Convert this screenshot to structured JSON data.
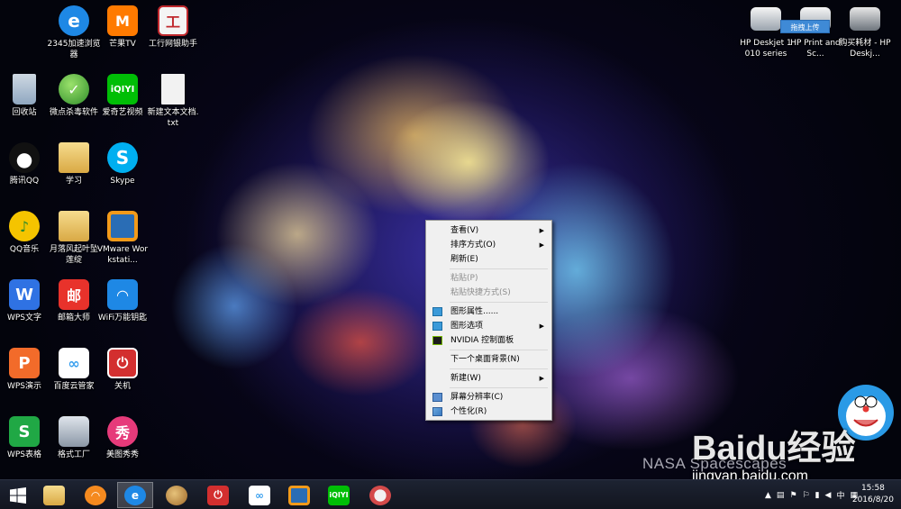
{
  "desktop": {
    "icons": [
      {
        "label": "2345加速浏览器",
        "icon": "ie-browser-icon",
        "color": "#1e88e5"
      },
      {
        "label": "芒果TV",
        "icon": "mango-tv-icon",
        "color": "#ff7a00"
      },
      {
        "label": "工行网银助手",
        "icon": "icbc-icon",
        "color": "#c0282d"
      },
      {
        "label": "回收站",
        "icon": "recycle-bin-icon",
        "color": "#8fa7c0"
      },
      {
        "label": "微点杀毒软件",
        "icon": "antivirus-icon",
        "color": "#47a83c"
      },
      {
        "label": "爱奇艺视频",
        "icon": "iqiyi-icon",
        "color": "#00be06"
      },
      {
        "label": "新建文本文档.txt",
        "icon": "text-file-icon",
        "color": "#f2f2f2"
      },
      {
        "label": "腾讯QQ",
        "icon": "qq-penguin-icon",
        "color": "#111111"
      },
      {
        "label": "学习",
        "icon": "folder-icon",
        "color": "#e8c265"
      },
      {
        "label": "Skype",
        "icon": "skype-icon",
        "color": "#00aff0"
      },
      {
        "label": "QQ音乐",
        "icon": "qq-music-icon",
        "color": "#f5c400"
      },
      {
        "label": "月落风起叶坠莲绽",
        "icon": "folder-icon",
        "color": "#e8c265"
      },
      {
        "label": "VMware Workstati...",
        "icon": "vmware-icon",
        "color": "#f29a1a"
      },
      {
        "label": "WPS文字",
        "icon": "wps-writer-icon",
        "color": "#2f72e3"
      },
      {
        "label": "邮箱大师",
        "icon": "mail-master-icon",
        "color": "#e8322b"
      },
      {
        "label": "WiFi万能钥匙",
        "icon": "wifi-key-icon",
        "color": "#1e88e5"
      },
      {
        "label": "WPS演示",
        "icon": "wps-presentation-icon",
        "color": "#f26b2a"
      },
      {
        "label": "百度云管家",
        "icon": "baidu-cloud-icon",
        "color": "#3aa0ee"
      },
      {
        "label": "关机",
        "icon": "power-icon",
        "color": "#d32f2f"
      },
      {
        "label": "WPS表格",
        "icon": "wps-spreadsheet-icon",
        "color": "#20a845"
      },
      {
        "label": "格式工厂",
        "icon": "format-factory-icon",
        "color": "#9aa6b5"
      },
      {
        "label": "美图秀秀",
        "icon": "meitu-icon",
        "color": "#e63a7a"
      }
    ],
    "right_icons": [
      {
        "label": "HP Deskjet 1010 series",
        "icon": "printer-icon"
      },
      {
        "label": "HP Print and Sc...",
        "icon": "scanner-icon"
      },
      {
        "label": "购买耗材 - HP Deskj...",
        "icon": "printer-supplies-icon"
      }
    ],
    "tooltip": "拖拽上传",
    "watermark": "NASA Spacescapes",
    "baidu_logo": "Baidu经验",
    "baidu_url": "jingyan.baidu.com"
  },
  "context_menu": {
    "items": [
      {
        "label": "查看(V)",
        "submenu": true,
        "disabled": false
      },
      {
        "label": "排序方式(O)",
        "submenu": true,
        "disabled": false
      },
      {
        "label": "刷新(E)",
        "submenu": false,
        "disabled": false
      },
      {
        "separator": true
      },
      {
        "label": "粘贴(P)",
        "submenu": false,
        "disabled": true
      },
      {
        "label": "粘贴快捷方式(S)",
        "submenu": false,
        "disabled": true
      },
      {
        "separator": true
      },
      {
        "label": "图形属性......",
        "submenu": false,
        "disabled": false,
        "icon": "intel-graphics-icon"
      },
      {
        "label": "图形选项",
        "submenu": true,
        "disabled": false,
        "icon": "intel-graphics-icon"
      },
      {
        "label": "NVIDIA 控制面板",
        "submenu": false,
        "disabled": false,
        "icon": "nvidia-icon"
      },
      {
        "separator": true
      },
      {
        "label": "下一个桌面背景(N)",
        "submenu": false,
        "disabled": false
      },
      {
        "separator": true
      },
      {
        "label": "新建(W)",
        "submenu": true,
        "disabled": false
      },
      {
        "separator": true
      },
      {
        "label": "屏幕分辨率(C)",
        "submenu": false,
        "disabled": false,
        "icon": "display-icon"
      },
      {
        "label": "个性化(R)",
        "submenu": false,
        "disabled": false,
        "icon": "personalize-icon"
      }
    ]
  },
  "taskbar": {
    "start_icon": "windows-start-icon",
    "apps": [
      {
        "icon": "file-explorer-icon",
        "color": "#e8c265"
      },
      {
        "icon": "wifi-key-icon",
        "color": "#f58a1f"
      },
      {
        "icon": "ie-browser-icon",
        "color": "#1e88e5",
        "active": true
      },
      {
        "icon": "paint-icon",
        "color": "#c58a3a"
      },
      {
        "icon": "power-icon",
        "color": "#d32f2f"
      },
      {
        "icon": "baidu-cloud-icon",
        "color": "#3aa0ee"
      },
      {
        "icon": "vmware-icon",
        "color": "#f29a1a"
      },
      {
        "icon": "iqiyi-icon",
        "color": "#00be06"
      },
      {
        "icon": "snipping-tool-icon",
        "color": "#d44a4a"
      }
    ],
    "tray_ime": "中",
    "clock_time": "15:58",
    "clock_date": "2016/8/20"
  }
}
